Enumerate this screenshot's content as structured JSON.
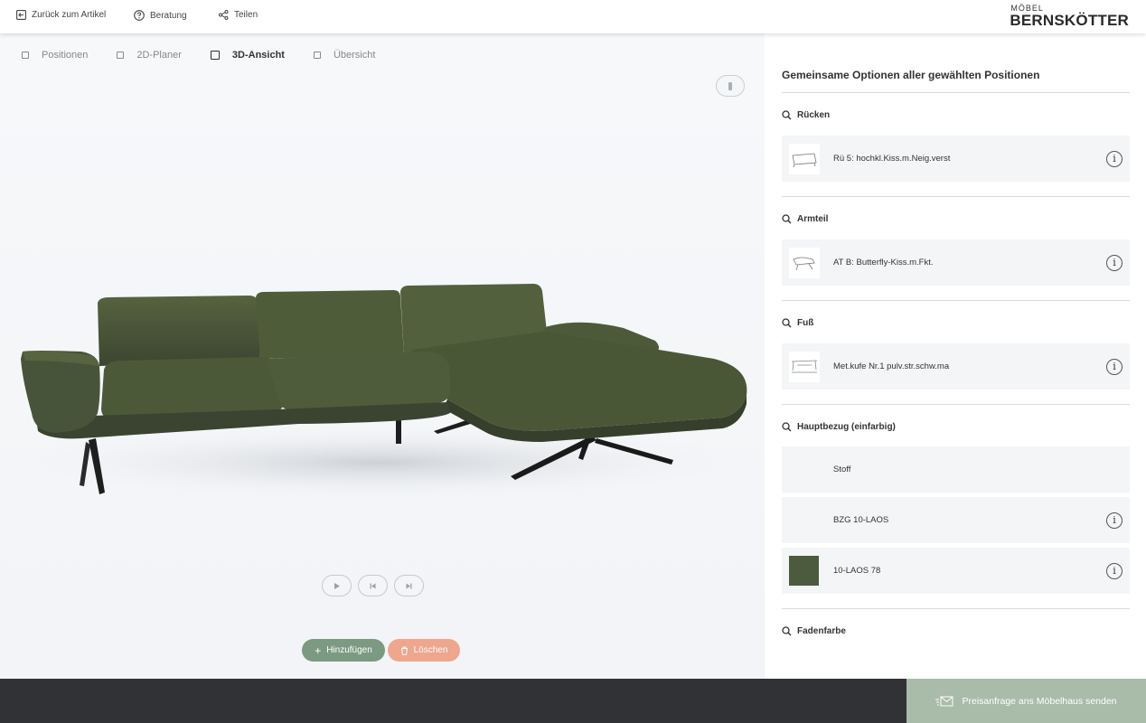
{
  "header": {
    "back_label": "Zurück zum Artikel",
    "help_label": "Beratung",
    "share_label": "Teilen",
    "logo_top": "MÖBEL",
    "logo_main": "BERNSKÖTTER"
  },
  "tabs": [
    {
      "label": "Positionen",
      "active": false
    },
    {
      "label": "2D-Planer",
      "active": false
    },
    {
      "label": "3D-Ansicht",
      "active": true
    },
    {
      "label": "Übersicht",
      "active": false
    }
  ],
  "actions": {
    "add_label": "Hinzufügen",
    "delete_label": "Löschen"
  },
  "panel": {
    "title": "Gemeinsame Optionen aller gewählten Positionen",
    "sections": [
      {
        "title": "Rücken",
        "options": [
          {
            "label": "Rü 5: hochkl.Kiss.m.Neig.verst",
            "info": true
          }
        ]
      },
      {
        "title": "Armteil",
        "options": [
          {
            "label": "AT B: Butterfly-Kiss.m.Fkt.",
            "info": true
          }
        ]
      },
      {
        "title": "Fuß",
        "options": [
          {
            "label": "Met.kufe Nr.1 pulv.str.schw.ma",
            "info": true
          }
        ]
      },
      {
        "title": "Hauptbezug (einfarbig)",
        "options": [
          {
            "label": "Stoff",
            "info": false
          },
          {
            "label": "BZG 10-LAOS",
            "info": true
          },
          {
            "label": "10-LAOS 78",
            "info": true
          }
        ]
      },
      {
        "title": "Fadenfarbe",
        "options": []
      }
    ]
  },
  "info_glyph": "i",
  "footer": {
    "send_label": "Preisanfrage ans Möbelhaus senden"
  },
  "colors": {
    "sofa_fabric": "#4c5a3e",
    "add_button": "#7c9a81",
    "delete_button": "#eea68c",
    "send_button": "#a9bba9",
    "footer": "#303236"
  }
}
